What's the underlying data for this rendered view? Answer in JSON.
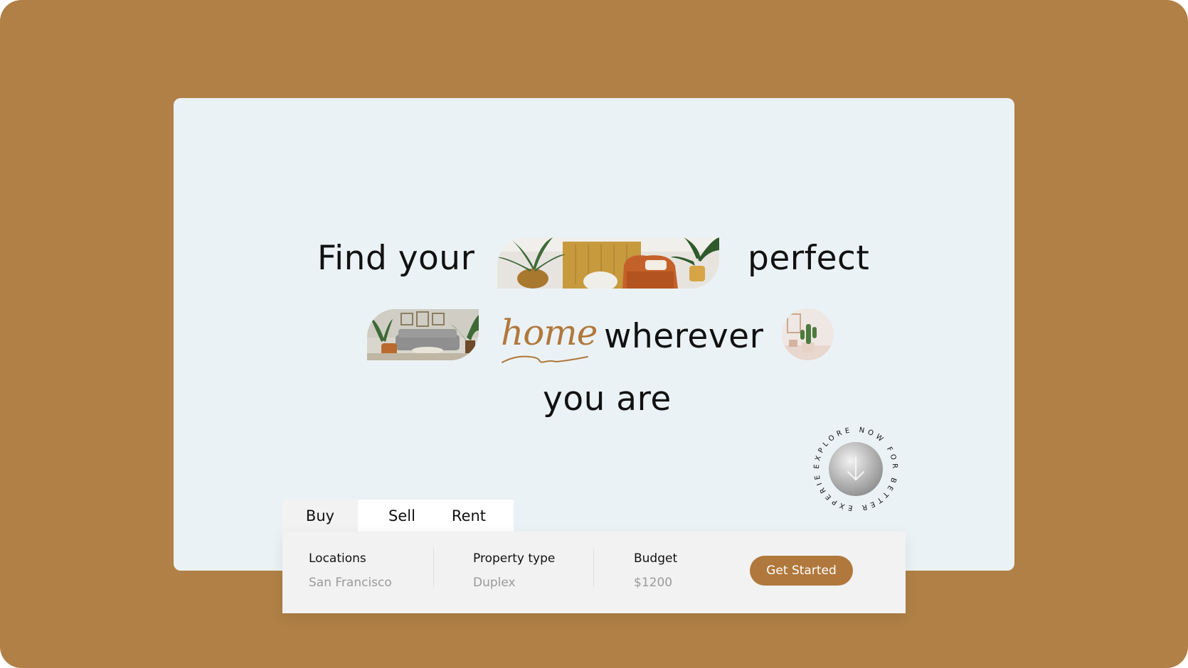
{
  "colors": {
    "background": "#b08046",
    "hero_bg": "#ebf2f5",
    "accent": "#b0783c",
    "text": "#111111",
    "muted": "#9a9a9a"
  },
  "hero": {
    "line1_word1": "Find your",
    "line1_word2": "perfect",
    "accent_word": "home",
    "line2_word": "wherever",
    "line3_word": "you are",
    "images": [
      "living-room-orange-armchair-image",
      "living-room-grey-sofa-image",
      "cactus-decor-image"
    ]
  },
  "badge": {
    "circular_text": "EXPLORE NOW FOR BETTER EXPERIENCE",
    "icon": "arrow-down-icon"
  },
  "tabs": [
    {
      "label": "Buy",
      "active": true
    },
    {
      "label": "Sell",
      "active": false
    },
    {
      "label": "Rent",
      "active": false
    }
  ],
  "search": {
    "location": {
      "label": "Locations",
      "value": "San Francisco"
    },
    "property_type": {
      "label": "Property type",
      "value": "Duplex"
    },
    "budget": {
      "label": "Budget",
      "value": "$1200"
    },
    "cta_label": "Get Started"
  }
}
